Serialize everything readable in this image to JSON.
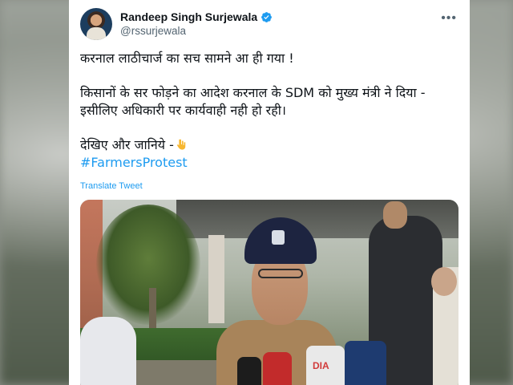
{
  "tweet": {
    "author_name": "Randeep Singh Surjewala",
    "handle": "@rssurjewala",
    "verified": true,
    "more_label": "•••",
    "lines": [
      "करनाल लाठीचार्ज का सच सामने आ ही गया !",
      "किसानों के सर फोड़ने का आदेश करनाल के SDM को मुख्य मंत्री ने दिया - इसीलिए अधिकारी पर कार्यवाही नही हो रही।",
      "देखिए और जानिये -"
    ],
    "emoji": "backhand-index-pointing-down",
    "hashtag": "#FarmersProtest",
    "translate_label": "Translate Tweet",
    "media_mic_text": "DIA"
  },
  "colors": {
    "link": "#1d9bf0",
    "text": "#0f1419",
    "secondary": "#536471",
    "verified_badge": "#1d9bf0"
  }
}
